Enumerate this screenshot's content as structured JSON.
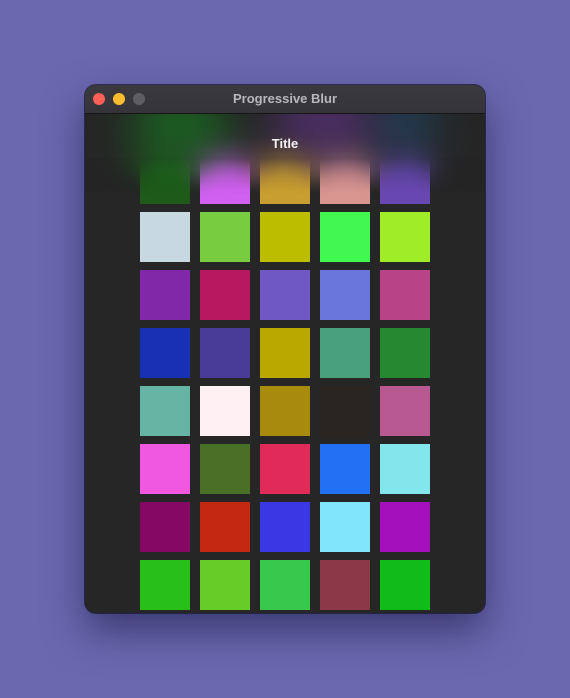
{
  "window": {
    "title": "Progressive Blur"
  },
  "toolbar": {
    "title": "Title"
  },
  "grid": {
    "rows": [
      [
        "#1f5a1a",
        "#d060f0",
        "#c89e30",
        "#d89590",
        "#6848b0"
      ],
      [
        "#c8d8e0",
        "#78cc40",
        "#bcbc00",
        "#40f850",
        "#a0ec28"
      ],
      [
        "#8028a8",
        "#b81860",
        "#7058c4",
        "#6a76dc",
        "#b84488"
      ],
      [
        "#1830b4",
        "#483c98",
        "#b8a800",
        "#48a07c",
        "#268830"
      ],
      [
        "#66b4a4",
        "#fff0f4",
        "#a88a0c",
        "#2a2520",
        "#b85890"
      ],
      [
        "#f058e0",
        "#4a7028",
        "#e02a58",
        "#2470f4",
        "#84e6ec"
      ],
      [
        "#840864",
        "#c42810",
        "#3a38e4",
        "#80e6fc",
        "#a410bc"
      ],
      [
        "#28c018",
        "#68cc28",
        "#38c84c",
        "#8c3848",
        "#10bc18"
      ]
    ]
  }
}
